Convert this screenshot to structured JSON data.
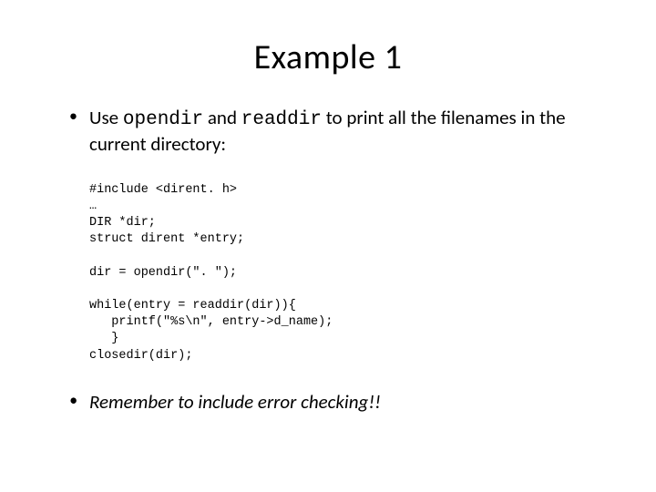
{
  "title": "Example 1",
  "bullet1": {
    "pre": "Use ",
    "code1": "opendir",
    "mid": " and ",
    "code2": "readdir",
    "post": " to print all the filenames in the current directory:"
  },
  "code": "#include <dirent. h>\n…\nDIR *dir;\nstruct dirent *entry;\n\ndir = opendir(\". \");\n\nwhile(entry = readdir(dir)){\n   printf(\"%s\\n\", entry->d_name);\n   }\nclosedir(dir);",
  "bullet2": "Remember to include error checking!!"
}
